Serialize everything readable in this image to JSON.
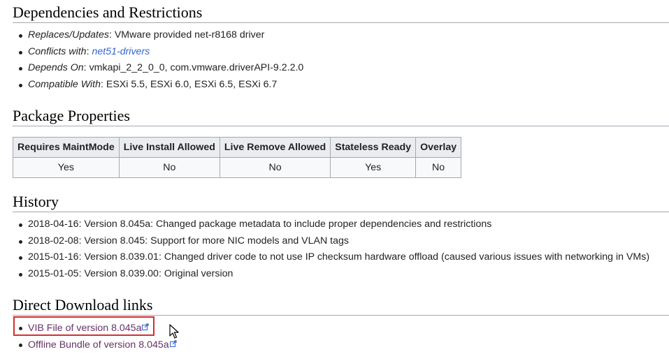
{
  "sections": {
    "dependencies_title": "Dependencies and Restrictions",
    "package_title": "Package Properties",
    "history_title": "History",
    "downloads_title": "Direct Download links"
  },
  "dependencies": [
    {
      "label": "Replaces/Updates",
      "sep": ": ",
      "value": "VMware provided net-r8168 driver",
      "is_link": false
    },
    {
      "label": "Conflicts with",
      "sep": ": ",
      "value": "net51-drivers",
      "is_link": true
    },
    {
      "label": "Depends On",
      "sep": ": ",
      "value": "vmkapi_2_2_0_0, com.vmware.driverAPI-9.2.2.0",
      "is_link": false
    },
    {
      "label": "Compatible With",
      "sep": ": ",
      "value": "ESXi 5.5, ESXi 6.0, ESXi 6.5, ESXi 6.7",
      "is_link": false
    }
  ],
  "properties": {
    "headers": [
      "Requires MaintMode",
      "Live Install Allowed",
      "Live Remove Allowed",
      "Stateless Ready",
      "Overlay"
    ],
    "values": [
      "Yes",
      "No",
      "No",
      "Yes",
      "No"
    ]
  },
  "history": [
    "2018-04-16: Version 8.045a: Changed package metadata to include proper dependencies and restrictions",
    "2018-02-08: Version 8.045: Support for more NIC models and VLAN tags",
    "2015-01-16: Version 8.039.01: Changed driver code to not use IP checksum hardware offload (caused various issues with networking in VMs)",
    "2015-01-05: Version 8.039.00: Original version"
  ],
  "downloads": [
    {
      "label": "VIB File of version 8.045a",
      "icon": "external-link-icon",
      "highlighted": true
    },
    {
      "label": "Offline Bundle of version 8.045a",
      "icon": "external-link-icon",
      "highlighted": false
    }
  ],
  "colors": {
    "link": "#3366cc",
    "visited_link": "#663366",
    "highlight_border": "#d32f2f",
    "table_header_bg": "#eaecf0",
    "table_border": "#a2a9b1"
  },
  "cursor": {
    "icon": "mouse-pointer-icon"
  }
}
